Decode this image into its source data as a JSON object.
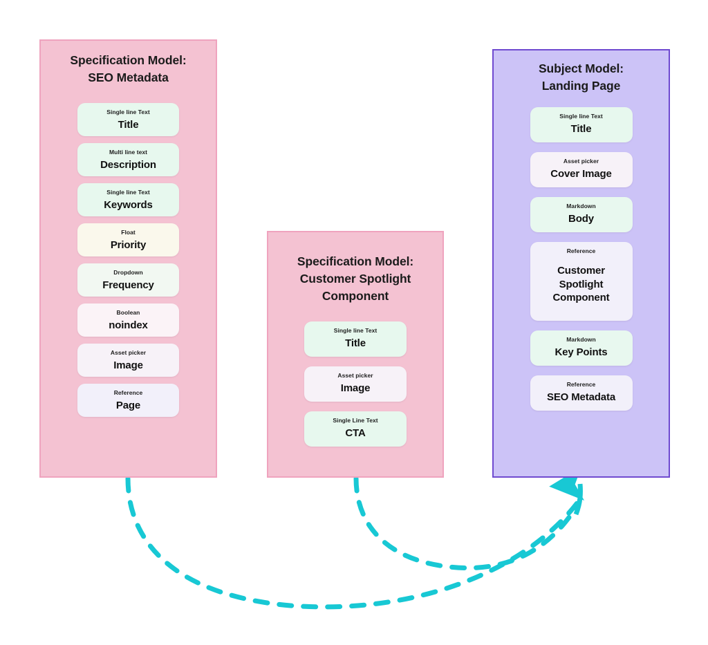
{
  "colors": {
    "spec_box_fill": "#f4c2d2",
    "spec_box_border": "#efa3be",
    "subject_box_fill": "#ccc3f7",
    "subject_box_border": "#6f4ad0",
    "arrow": "#18c8d4",
    "card_text": "#e7f8ee",
    "card_float": "#faf8ec",
    "card_dropdown": "#f2f8f2",
    "card_boolean": "#fbf3f7",
    "card_asset": "#f7f2f8",
    "card_reference": "#f2f0fa",
    "page_background": "#ffffff"
  },
  "models": [
    {
      "id": "seo-metadata",
      "kind": "specification",
      "title": "Specification Model:\nSEO Metadata",
      "title_lines": [
        "Specification Model:",
        "SEO Metadata"
      ],
      "fields": [
        {
          "kind": "Single line Text",
          "name": "Title",
          "tint": "tint-text"
        },
        {
          "kind": "Multi line text",
          "name": "Description",
          "tint": "tint-text"
        },
        {
          "kind": "Single line Text",
          "name": "Keywords",
          "tint": "tint-text"
        },
        {
          "kind": "Float",
          "name": "Priority",
          "tint": "tint-float"
        },
        {
          "kind": "Dropdown",
          "name": "Frequency",
          "tint": "tint-dropdown"
        },
        {
          "kind": "Boolean",
          "name": "noindex",
          "tint": "tint-boolean"
        },
        {
          "kind": "Asset picker",
          "name": "Image",
          "tint": "tint-asset"
        },
        {
          "kind": "Reference",
          "name": "Page",
          "tint": "tint-reference"
        }
      ]
    },
    {
      "id": "customer-spotlight-component",
      "kind": "specification",
      "title": "Specification Model:\nCustomer Spotlight Component",
      "title_lines": [
        "Specification Model:",
        "Customer Spotlight",
        "Component"
      ],
      "fields": [
        {
          "kind": "Single line Text",
          "name": "Title",
          "tint": "tint-text"
        },
        {
          "kind": "Asset picker",
          "name": "Image",
          "tint": "tint-asset"
        },
        {
          "kind": "Single Line Text",
          "name": "CTA",
          "tint": "tint-text"
        }
      ]
    },
    {
      "id": "landing-page",
      "kind": "subject",
      "title": "Subject Model:\nLanding Page",
      "title_lines": [
        "Subject Model:",
        "Landing Page"
      ],
      "fields": [
        {
          "kind": "Single line Text",
          "name": "Title",
          "tint": "tint-text"
        },
        {
          "kind": "Asset picker",
          "name": "Cover Image",
          "tint": "tint-asset"
        },
        {
          "kind": "Markdown",
          "name": "Body",
          "tint": "tint-markdown"
        },
        {
          "kind": "Reference",
          "name": "Customer Spotlight Component",
          "tint": "tint-reference",
          "tall": true
        },
        {
          "kind": "Markdown",
          "name": "Key Points",
          "tint": "tint-markdown"
        },
        {
          "kind": "Reference",
          "name": "SEO Metadata",
          "tint": "tint-reference"
        }
      ]
    }
  ],
  "connectors": [
    {
      "id": "seo-to-landing-page",
      "from": "seo-metadata",
      "to": "landing-page",
      "style": "dashed",
      "arrowhead": true
    },
    {
      "id": "spotlight-component-to-landing",
      "from": "customer-spotlight-component",
      "to": "landing-page",
      "style": "dashed",
      "arrowhead": true
    }
  ]
}
